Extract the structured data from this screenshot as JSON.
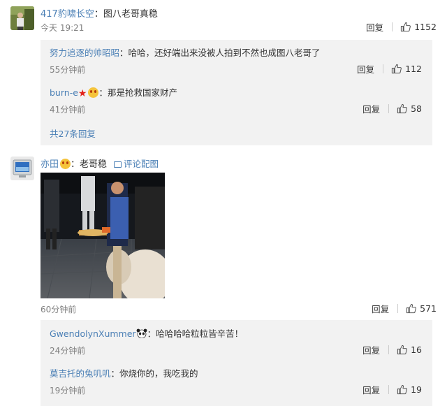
{
  "comments": [
    {
      "username": "417豹啸长空",
      "text": "图八老哥真稳",
      "time": "今天 19:21",
      "reply_label": "回复",
      "likes": "1152",
      "replies": [
        {
          "username": "努力追逐的帅昭昭",
          "text": "哈哈，还好端出来没被人拍到不然也成图八老哥了",
          "time": "55分钟前",
          "reply_label": "回复",
          "likes": "112"
        },
        {
          "username": "burn-e",
          "text": "那是抢救国家财产",
          "time": "41分钟前",
          "reply_label": "回复",
          "likes": "58"
        }
      ],
      "more_replies": "共27条回复"
    },
    {
      "username": "亦田",
      "text": "老哥稳",
      "image_link": "评论配图",
      "time": "60分钟前",
      "reply_label": "回复",
      "likes": "571",
      "replies": [
        {
          "username": "GwendolynXummer",
          "text": "哈哈哈哈粒粒皆辛苦！",
          "time": "24分钟前",
          "reply_label": "回复",
          "likes": "16"
        },
        {
          "username": "莫吉托的兔叽叽",
          "text": "你烧你的，我吃我的",
          "time": "19分钟前",
          "reply_label": "回复",
          "likes": "19"
        }
      ]
    }
  ],
  "colors": {
    "link": "#4a7fb5",
    "reply_bg": "#f2f2f2",
    "text": "#333333",
    "meta": "#808080"
  },
  "icons": {
    "like": "thumbs-up-icon",
    "image": "image-icon",
    "emoji": "emoji-face-icon",
    "star": "red-star-icon",
    "panda": "panda-emoji-icon"
  }
}
